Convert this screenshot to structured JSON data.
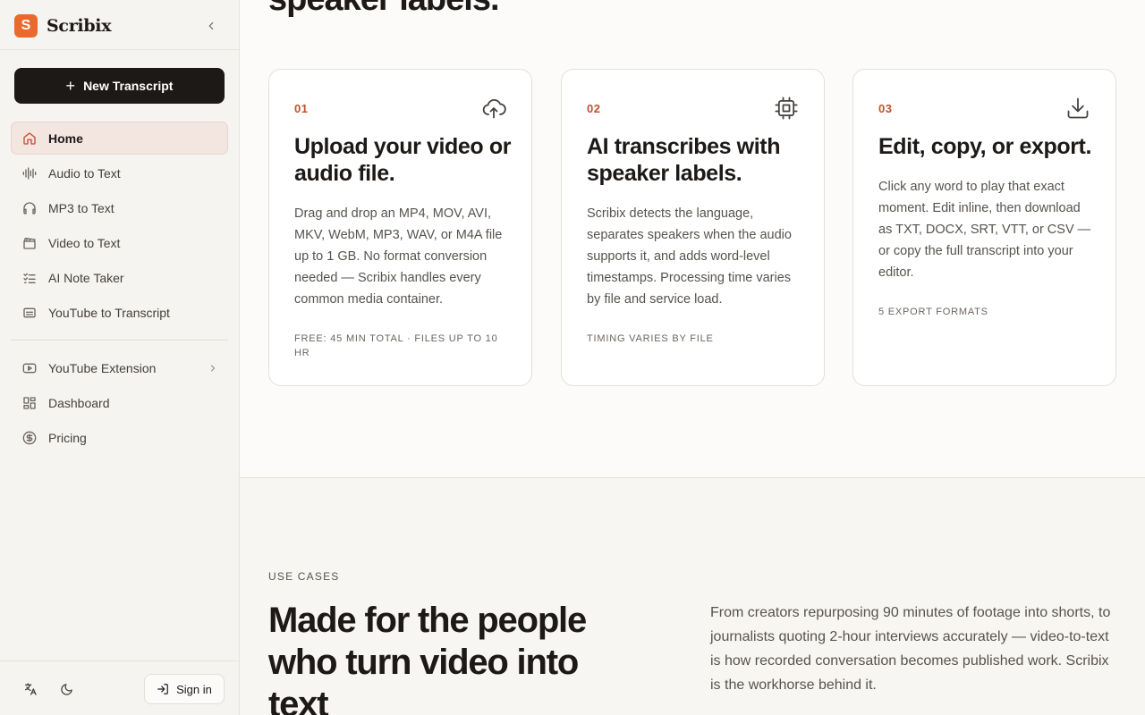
{
  "brand": {
    "logo_letter": "S",
    "name": "Scribix",
    "accent": "#ea6a2e"
  },
  "sidebar": {
    "new_button": "New Transcript",
    "primary_items": [
      {
        "label": "Home",
        "icon": "home-icon",
        "active": true
      },
      {
        "label": "Audio to Text",
        "icon": "audio-wave-icon"
      },
      {
        "label": "MP3 to Text",
        "icon": "headphones-icon"
      },
      {
        "label": "Video to Text",
        "icon": "clapperboard-icon"
      },
      {
        "label": "AI Note Taker",
        "icon": "checklist-icon"
      },
      {
        "label": "YouTube to Transcript",
        "icon": "captions-icon"
      }
    ],
    "secondary_items": [
      {
        "label": "YouTube Extension",
        "icon": "youtube-icon",
        "has_submenu": true
      },
      {
        "label": "Dashboard",
        "icon": "dashboard-grid-icon"
      },
      {
        "label": "Pricing",
        "icon": "dollar-circle-icon"
      }
    ],
    "footer": {
      "sign_in": "Sign in",
      "language_icon": "translate-icon",
      "theme_icon": "moon-icon"
    }
  },
  "main": {
    "partial_heading": "speaker labels.",
    "steps": [
      {
        "number": "01",
        "icon": "cloud-upload-icon",
        "title": "Upload your video or audio file.",
        "body": "Drag and drop an MP4, MOV, AVI, MKV, WebM, MP3, WAV, or M4A file up to 1 GB. No format conversion needed — Scribix handles every common media container.",
        "tag": "FREE: 45 MIN TOTAL · FILES UP TO 10 HR"
      },
      {
        "number": "02",
        "icon": "cpu-chip-icon",
        "title": "AI transcribes with speaker labels.",
        "body": "Scribix detects the language, separates speakers when the audio supports it, and adds word-level timestamps. Processing time varies by file and service load.",
        "tag": "TIMING VARIES BY FILE"
      },
      {
        "number": "03",
        "icon": "download-icon",
        "title": "Edit, copy, or export.",
        "body": "Click any word to play that exact moment. Edit inline, then download as TXT, DOCX, SRT, VTT, or CSV — or copy the full transcript into your editor.",
        "tag": "5 EXPORT FORMATS"
      }
    ],
    "use_cases": {
      "eyebrow": "USE CASES",
      "heading": "Made for the people who turn video into text",
      "paragraph": "From creators repurposing 90 minutes of footage into shorts, to journalists quoting 2-hour interviews accurately — video-to-text is how recorded conversation becomes published work. Scribix is the workhorse behind it."
    }
  }
}
